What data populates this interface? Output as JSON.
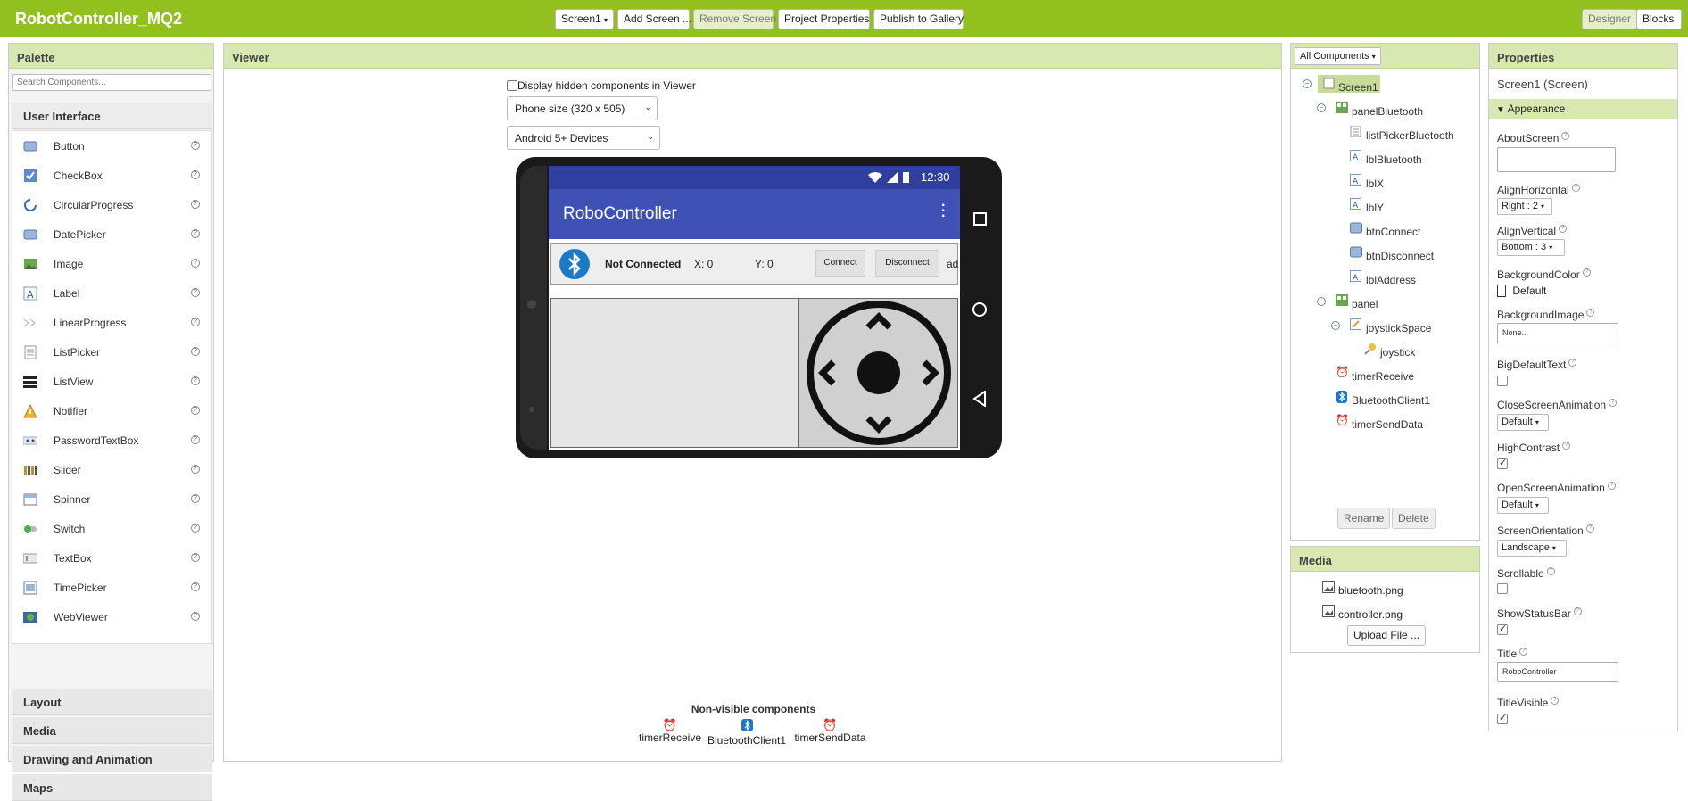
{
  "app": {
    "project_name": "RobotController_MQ2",
    "screen_dropdown": "Screen1",
    "add_screen": "Add Screen ...",
    "remove_screen": "Remove Screen",
    "project_properties": "Project Properties",
    "publish": "Publish to Gallery",
    "designer": "Designer",
    "blocks": "Blocks"
  },
  "palette": {
    "title": "Palette",
    "search_placeholder": "Search Components...",
    "category_ui": "User Interface",
    "items": [
      {
        "label": "Button",
        "icon": "button-icon"
      },
      {
        "label": "CheckBox",
        "icon": "checkbox-icon"
      },
      {
        "label": "CircularProgress",
        "icon": "circular-progress-icon"
      },
      {
        "label": "DatePicker",
        "icon": "datepicker-icon"
      },
      {
        "label": "Image",
        "icon": "image-icon"
      },
      {
        "label": "Label",
        "icon": "label-icon"
      },
      {
        "label": "LinearProgress",
        "icon": "linear-progress-icon"
      },
      {
        "label": "ListPicker",
        "icon": "listpicker-icon"
      },
      {
        "label": "ListView",
        "icon": "listview-icon"
      },
      {
        "label": "Notifier",
        "icon": "notifier-icon"
      },
      {
        "label": "PasswordTextBox",
        "icon": "password-icon"
      },
      {
        "label": "Slider",
        "icon": "slider-icon"
      },
      {
        "label": "Spinner",
        "icon": "spinner-icon"
      },
      {
        "label": "Switch",
        "icon": "switch-icon"
      },
      {
        "label": "TextBox",
        "icon": "textbox-icon"
      },
      {
        "label": "TimePicker",
        "icon": "timepicker-icon"
      },
      {
        "label": "WebViewer",
        "icon": "webviewer-icon"
      }
    ],
    "help_mark": "?",
    "category_layout": "Layout",
    "category_media": "Media",
    "category_drawing": "Drawing and Animation",
    "category_maps": "Maps"
  },
  "viewer": {
    "title": "Viewer",
    "hidden_checkbox_label": "Display hidden components in Viewer",
    "phone_size": "Phone size (320 x 505)",
    "device": "Android 5+ Devices",
    "status_time": "12:30",
    "app_title": "RoboController",
    "status_text": "Not Connected",
    "lbl_x": "X: 0",
    "lbl_y": "Y: 0",
    "connect": "Connect",
    "disconnect": "Disconnect",
    "address_partial": "ad",
    "nonvisible_title": "Non-visible components",
    "nonvisible": [
      "timerReceive",
      "BluetoothClient1",
      "timerSendData"
    ]
  },
  "tree": {
    "dropdown": "All Components",
    "items": [
      {
        "label": "Screen1"
      },
      {
        "label": "panelBluetooth"
      },
      {
        "label": "listPickerBluetooth"
      },
      {
        "label": "lblBluetooth"
      },
      {
        "label": "lblX"
      },
      {
        "label": "lblY"
      },
      {
        "label": "btnConnect"
      },
      {
        "label": "btnDisconnect"
      },
      {
        "label": "lblAddress"
      },
      {
        "label": "panel"
      },
      {
        "label": "joystickSpace"
      },
      {
        "label": "joystick"
      },
      {
        "label": "timerReceive"
      },
      {
        "label": "BluetoothClient1"
      },
      {
        "label": "timerSendData"
      }
    ],
    "rename": "Rename",
    "delete": "Delete"
  },
  "media": {
    "title": "Media",
    "files": [
      "bluetooth.png",
      "controller.png"
    ],
    "upload": "Upload File ..."
  },
  "properties": {
    "title": "Properties",
    "subject": "Screen1 (Screen)",
    "section": "Appearance",
    "about_screen": "AboutScreen",
    "align_horizontal": "AlignHorizontal",
    "align_horizontal_value": "Right : 2",
    "align_vertical": "AlignVertical",
    "align_vertical_value": "Bottom : 3",
    "background_color": "BackgroundColor",
    "background_color_value": "Default",
    "background_image": "BackgroundImage",
    "background_image_value": "None...",
    "big_default_text": "BigDefaultText",
    "big_default_text_checked": false,
    "close_anim": "CloseScreenAnimation",
    "close_anim_value": "Default",
    "high_contrast": "HighContrast",
    "high_contrast_checked": true,
    "open_anim": "OpenScreenAnimation",
    "open_anim_value": "Default",
    "orientation": "ScreenOrientation",
    "orientation_value": "Landscape",
    "scrollable": "Scrollable",
    "scrollable_checked": false,
    "show_status_bar": "ShowStatusBar",
    "show_status_bar_checked": true,
    "title_label": "Title",
    "title_value": "RoboController",
    "title_visible": "TitleVisible",
    "title_visible_checked": true
  },
  "colors": {
    "topbar": "#92c01f",
    "app_bar": "#3f51b5",
    "status_bar": "#303f9f",
    "header": "#d8e8b0"
  }
}
